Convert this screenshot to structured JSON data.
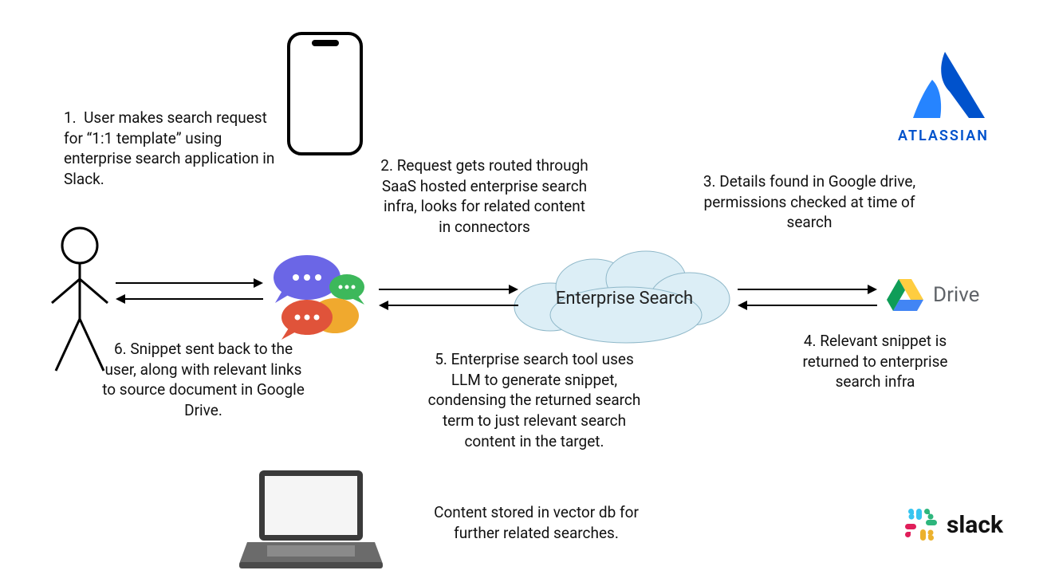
{
  "steps": {
    "s1": "1.  User makes search request for “1:1 template” using enterprise search application in Slack.",
    "s2": "2. Request gets routed through SaaS hosted enterprise search infra, looks for related content in connectors",
    "s3": "3. Details found in Google drive, permissions checked at time of search",
    "s4": "4. Relevant snippet is returned to enterprise search infra",
    "s5a": "5. Enterprise search tool uses LLM to generate snippet, condensing the returned search term to just relevant search content in the target.",
    "s5b": "Content stored in vector db for further related searches.",
    "s6": "6. Snippet sent back to the user, along with relevant links to source document in Google Drive."
  },
  "labels": {
    "cloud": "Enterprise Search",
    "drive": "Drive",
    "atlassian": "ATLASSIAN",
    "slack": "slack"
  },
  "logos": {
    "atlassian_color": "#2684ff",
    "slack_colors": {
      "yellow": "#ecb22e",
      "green": "#2eb67d",
      "red": "#e01e5a",
      "blue": "#36c5f0"
    },
    "drive_colors": {
      "green": "#0f9d58",
      "yellow": "#ffcd40",
      "blue": "#4285f4",
      "red": "#ea4335"
    }
  }
}
